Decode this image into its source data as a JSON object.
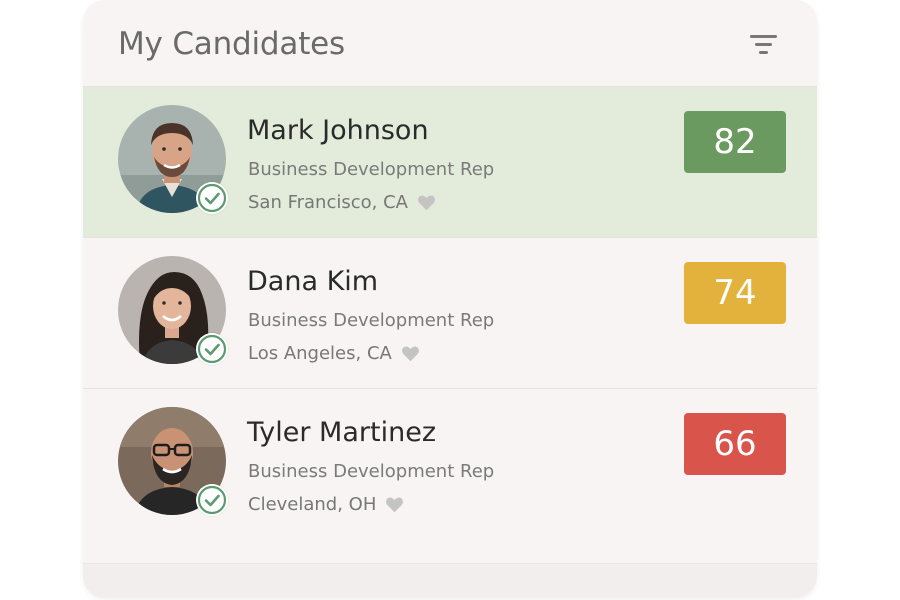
{
  "header": {
    "title": "My Candidates",
    "filter_icon": "filter-icon"
  },
  "candidates": [
    {
      "name": "Mark Johnson",
      "role": "Business Development Rep",
      "location": "San Francisco, CA",
      "score": "82",
      "score_color": "#6a9a5f",
      "selected": true,
      "verified": true
    },
    {
      "name": "Dana Kim",
      "role": "Business Development Rep",
      "location": "Los Angeles, CA",
      "score": "74",
      "score_color": "#e2b23c",
      "selected": false,
      "verified": true
    },
    {
      "name": "Tyler Martinez",
      "role": "Business Development Rep",
      "location": "Cleveland, OH",
      "score": "66",
      "score_color": "#d9544b",
      "selected": false,
      "verified": true
    }
  ],
  "colors": {
    "selected_row_bg": "#e3ecda",
    "verified_check": "#5c9a70",
    "heart": "#c4c4c4"
  }
}
